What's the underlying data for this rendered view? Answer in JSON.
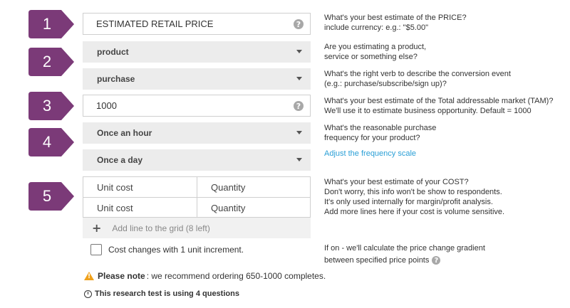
{
  "steps": [
    "1",
    "2",
    "3",
    "4",
    "5"
  ],
  "colors": {
    "step_marker": "#7b3a78",
    "link": "#2a9fd6",
    "warning": "#f0a11b"
  },
  "fields": {
    "price": {
      "placeholder": "ESTIMATED RETAIL PRICE"
    },
    "category": {
      "value": "product"
    },
    "verb": {
      "value": "purchase"
    },
    "tam": {
      "value": "1000"
    },
    "frequency_min": {
      "value": "Once an hour"
    },
    "frequency_max": {
      "value": "Once a day"
    }
  },
  "cost_grid": {
    "rows": [
      {
        "unit_cost": "Unit cost",
        "quantity": "Quantity"
      },
      {
        "unit_cost": "Unit cost",
        "quantity": "Quantity"
      }
    ],
    "add_line": "Add line to the grid (8 left)"
  },
  "cost_checkbox": {
    "label": "Cost changes with 1 unit increment.",
    "checked": false
  },
  "notes": {
    "please_note_bold": "Please note",
    "please_note_text": ": we recommend ordering 650-1000 completes.",
    "questions": "This research test is using 4 questions"
  },
  "descriptions": {
    "price": [
      "What's your best estimate of the PRICE?",
      "include currency: e.g.: \"$5.00\""
    ],
    "category": [
      "Are you estimating a product,",
      "service or something else?"
    ],
    "verb": [
      "What's the right verb to describe the conversion event",
      "(e.g.: purchase/subscribe/sign up)?"
    ],
    "tam": [
      "What's your best estimate of the Total addressable market (TAM)?",
      "We'll use it to estimate business opportunity. Default = 1000"
    ],
    "frequency": [
      "What's the reasonable purchase",
      "frequency for your product?"
    ],
    "frequency_link": "Adjust the frequency scale",
    "cost": [
      "What's your best estimate of your COST?",
      "Don't worry, this info won't be show to respondents.",
      "It's only used internally for margin/profit analysis.",
      "Add more lines here if your cost is volume sensitive."
    ],
    "gradient": [
      "If on - we'll calculate the price change gradient",
      "between specified price points"
    ]
  }
}
